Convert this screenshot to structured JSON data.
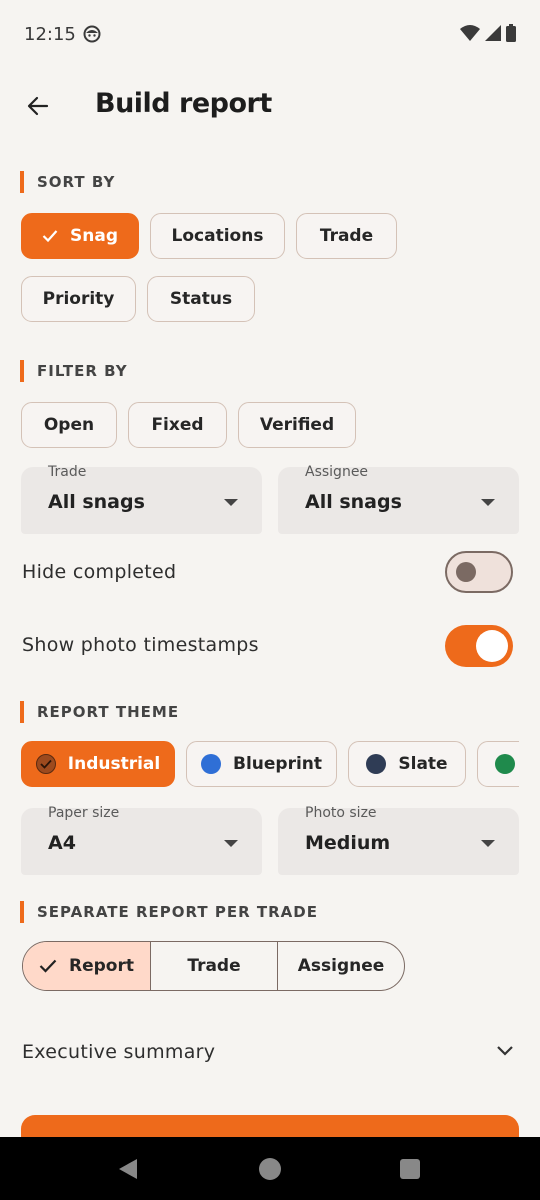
{
  "status": {
    "time": "12:15"
  },
  "header": {
    "title": "Build report"
  },
  "sort_by": {
    "heading": "SORT BY",
    "chips": [
      {
        "label": "Snag",
        "selected": true
      },
      {
        "label": "Locations",
        "selected": false
      },
      {
        "label": "Trade",
        "selected": false
      },
      {
        "label": "Priority",
        "selected": false
      },
      {
        "label": "Status",
        "selected": false
      }
    ]
  },
  "filter_by": {
    "heading": "FILTER BY",
    "chips": [
      {
        "label": "Open"
      },
      {
        "label": "Fixed"
      },
      {
        "label": "Verified"
      }
    ],
    "trade": {
      "label": "Trade",
      "value": "All snags"
    },
    "assignee": {
      "label": "Assignee",
      "value": "All snags"
    }
  },
  "toggles": {
    "hide_completed": {
      "label": "Hide completed",
      "on": false
    },
    "show_timestamps": {
      "label": "Show photo timestamps",
      "on": true
    }
  },
  "report_theme": {
    "heading": "REPORT THEME",
    "chips": [
      {
        "label": "Industrial",
        "color": "#9c4a1e",
        "selected": true
      },
      {
        "label": "Blueprint",
        "color": "#2f6fd6",
        "selected": false
      },
      {
        "label": "Slate",
        "color": "#2f3c55",
        "selected": false
      },
      {
        "label": "",
        "color": "#1f8a4c",
        "selected": false
      }
    ],
    "paper_size": {
      "label": "Paper size",
      "value": "A4"
    },
    "photo_size": {
      "label": "Photo size",
      "value": "Medium"
    }
  },
  "separate_report": {
    "heading": "SEPARATE REPORT PER TRADE",
    "segments": [
      {
        "label": "Report",
        "selected": true
      },
      {
        "label": "Trade",
        "selected": false
      },
      {
        "label": "Assignee",
        "selected": false
      }
    ]
  },
  "executive_summary": {
    "label": "Executive summary"
  },
  "colors": {
    "accent": "#ee6a1b",
    "background": "#f6f4f1",
    "selected_segment": "#ffd9c9"
  }
}
